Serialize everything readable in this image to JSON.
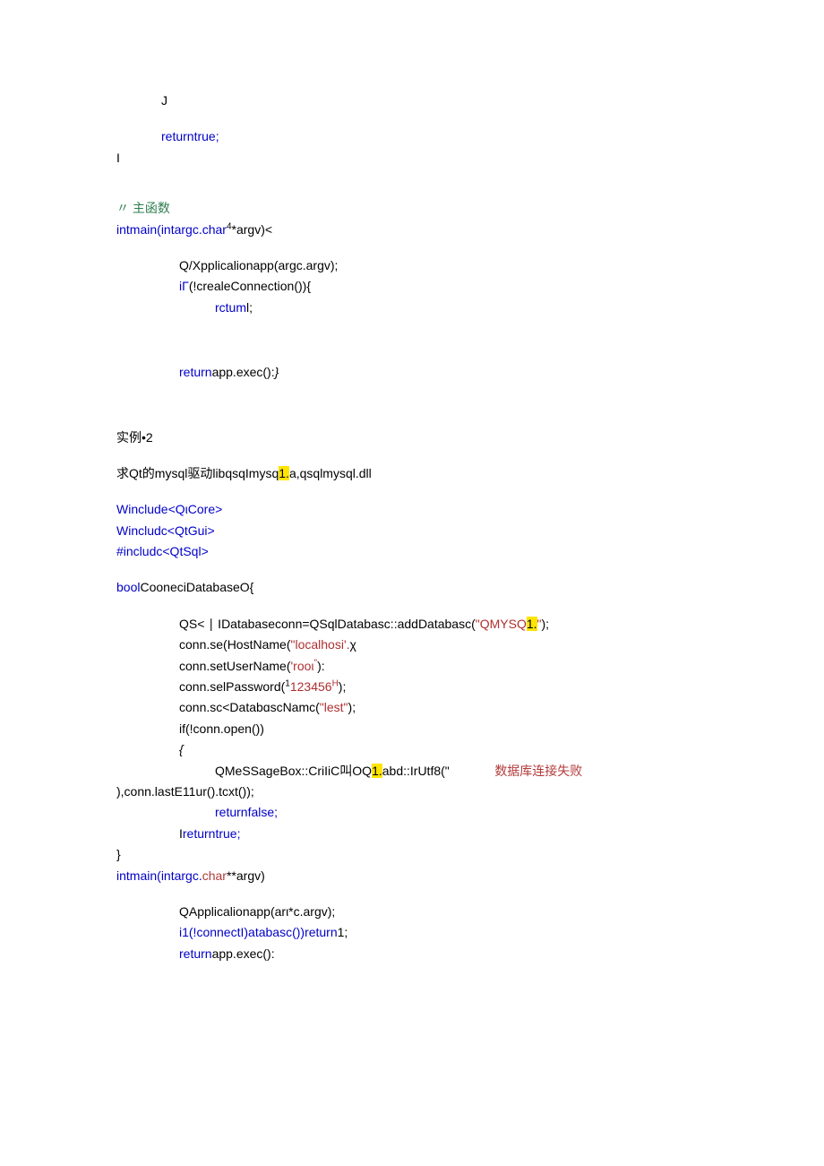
{
  "lines": [
    {
      "cls": "line indent1",
      "segments": [
        {
          "text": "J"
        }
      ]
    },
    {
      "cls": "blank"
    },
    {
      "cls": "line indent1",
      "segments": [
        {
          "text": "return",
          "color": "blue"
        },
        {
          "text": "true;",
          "color": "blue"
        }
      ]
    },
    {
      "cls": "line",
      "segments": [
        {
          "text": "I"
        }
      ]
    },
    {
      "cls": "blank2"
    },
    {
      "cls": "line",
      "segments": [
        {
          "text": "〃 主函数",
          "color": "green"
        }
      ]
    },
    {
      "cls": "line",
      "segments": [
        {
          "text": "int",
          "color": "blue"
        },
        {
          "text": "main(",
          "color": "blue"
        },
        {
          "text": "int",
          "color": "blue"
        },
        {
          "text": "argc.",
          "color": "blue"
        },
        {
          "text": "char",
          "color": "blue"
        },
        {
          "text": "4",
          "sup": true
        },
        {
          "text": "*argv)<"
        }
      ]
    },
    {
      "cls": "blank"
    },
    {
      "cls": "line indent2",
      "segments": [
        {
          "text": "Q/Xpplicalionapp(argc.argv);"
        }
      ]
    },
    {
      "cls": "line indent2",
      "segments": [
        {
          "text": "iΓ",
          "color": "blue"
        },
        {
          "text": "(!crealeConnection()){"
        }
      ]
    },
    {
      "cls": "line indent3",
      "segments": [
        {
          "text": "rctum",
          "color": "blue"
        },
        {
          "text": "l;"
        }
      ]
    },
    {
      "cls": "blank2"
    },
    {
      "cls": "blank"
    },
    {
      "cls": "line indent2",
      "segments": [
        {
          "text": "return",
          "color": "blue"
        },
        {
          "text": "app.exec():"
        },
        {
          "text": "}",
          "italic": true
        }
      ]
    },
    {
      "cls": "blank2"
    },
    {
      "cls": "blank"
    },
    {
      "cls": "line",
      "segments": [
        {
          "text": "实例•2"
        }
      ]
    },
    {
      "cls": "blank"
    },
    {
      "cls": "line",
      "segments": [
        {
          "text": "求Qt的mysql驱动libqsqImysq"
        },
        {
          "text": "1.",
          "hl": true
        },
        {
          "text": "a,qsqlmysql.dll"
        }
      ]
    },
    {
      "cls": "blank"
    },
    {
      "cls": "line",
      "segments": [
        {
          "text": "Winclude",
          "color": "blue"
        },
        {
          "text": "<QιCore>",
          "color": "blue"
        }
      ]
    },
    {
      "cls": "line",
      "segments": [
        {
          "text": "Wincludc",
          "color": "blue"
        },
        {
          "text": "<QtGui>",
          "color": "blue"
        }
      ]
    },
    {
      "cls": "line",
      "segments": [
        {
          "text": "#includc",
          "color": "blue"
        },
        {
          "text": "<QtSql>",
          "color": "blue"
        }
      ]
    },
    {
      "cls": "blank"
    },
    {
      "cls": "line",
      "segments": [
        {
          "text": "bool",
          "color": "blue"
        },
        {
          "text": "CooneciDatabaseO{"
        }
      ]
    },
    {
      "cls": "blank"
    },
    {
      "cls": "line indent2",
      "segments": [
        {
          "text": "QS< ∣ IDatabaseconn=QSqlDatabasc::addDatabasc("
        },
        {
          "text": "\"QMYSQ",
          "color": "red"
        },
        {
          "text": "1.",
          "hl": true,
          "color": "#b02f2f"
        },
        {
          "text": "\"",
          "color": "red"
        },
        {
          "text": ");"
        }
      ]
    },
    {
      "cls": "line indent2",
      "segments": [
        {
          "text": "conn.se(HostName("
        },
        {
          "text": "\"localhosi'.",
          "color": "red"
        },
        {
          "text": "χ"
        }
      ]
    },
    {
      "cls": "line indent2",
      "segments": [
        {
          "text": "conn.setUserName("
        },
        {
          "text": "'rooι",
          "color": "red"
        },
        {
          "text": "\"",
          "color": "red",
          "sup": true
        },
        {
          "text": "):"
        }
      ]
    },
    {
      "cls": "line indent2",
      "segments": [
        {
          "text": "conn.selPassword("
        },
        {
          "text": "1",
          "sup": true
        },
        {
          "text": "123456",
          "color": "red"
        },
        {
          "text": "H",
          "color": "red",
          "sup": true
        },
        {
          "text": ");"
        }
      ]
    },
    {
      "cls": "line indent2",
      "segments": [
        {
          "text": "conn.sc<DatabɑscNamc("
        },
        {
          "text": "\"lest\"",
          "color": "red"
        },
        {
          "text": ");"
        }
      ]
    },
    {
      "cls": "line indent2",
      "segments": [
        {
          "text": "if(!conn.open())"
        }
      ]
    },
    {
      "cls": "line indent2",
      "segments": [
        {
          "text": "{",
          "italic": true
        }
      ]
    },
    {
      "cls": "line indent3",
      "segments": [
        {
          "text": "QMeSSageBox::CriIiC叫OQ"
        },
        {
          "text": "1.",
          "hl": true
        },
        {
          "text": "abd::IrUtf8(\"             "
        },
        {
          "text": "数据库连接失败",
          "color": "redlink"
        }
      ]
    },
    {
      "cls": "line",
      "segments": [
        {
          "text": "),conn.lastE11ur().tcxt());"
        }
      ]
    },
    {
      "cls": "line indent3",
      "segments": [
        {
          "text": "return",
          "color": "blue"
        },
        {
          "text": "false;",
          "color": "blue"
        }
      ]
    },
    {
      "cls": "line indent2",
      "segments": [
        {
          "text": "I"
        },
        {
          "text": "return",
          "color": "blue"
        },
        {
          "text": "true;",
          "color": "blue"
        }
      ]
    },
    {
      "cls": "line",
      "segments": [
        {
          "text": "}"
        }
      ]
    },
    {
      "cls": "line",
      "segments": [
        {
          "text": "int",
          "color": "blue"
        },
        {
          "text": "main(",
          "color": "blue"
        },
        {
          "text": "int",
          "color": "blue"
        },
        {
          "text": "argc.",
          "color": "blue"
        },
        {
          "text": "char",
          "color": "redlink"
        },
        {
          "text": "**argv)"
        }
      ]
    },
    {
      "cls": "blank"
    },
    {
      "cls": "line indent2",
      "segments": [
        {
          "text": "QApplicalionapp(arι*c.argv);"
        }
      ]
    },
    {
      "cls": "line indent2",
      "segments": [
        {
          "text": "i1(!connectI)atabasc())",
          "color": "blue"
        },
        {
          "text": "return",
          "color": "blue"
        },
        {
          "text": "1;"
        }
      ]
    },
    {
      "cls": "line indent2",
      "segments": [
        {
          "text": "return",
          "color": "blue"
        },
        {
          "text": "app.exec():"
        }
      ]
    }
  ]
}
